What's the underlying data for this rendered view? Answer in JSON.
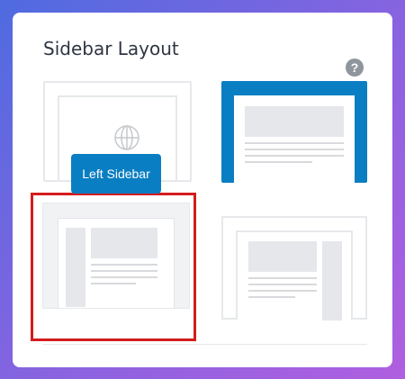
{
  "panel": {
    "title": "Sidebar Layout",
    "help_glyph": "?",
    "tooltip": "Left Sidebar",
    "options": [
      {
        "name": "no-sidebar",
        "icon": "globe-icon"
      },
      {
        "name": "full-width",
        "selected": true
      },
      {
        "name": "left-sidebar",
        "highlighted": true
      },
      {
        "name": "right-sidebar"
      }
    ]
  },
  "colors": {
    "accent": "#0a7ec2",
    "highlight_border": "#d41c1c",
    "background_gradient": [
      "#4f6be0",
      "#b05fe0"
    ]
  }
}
